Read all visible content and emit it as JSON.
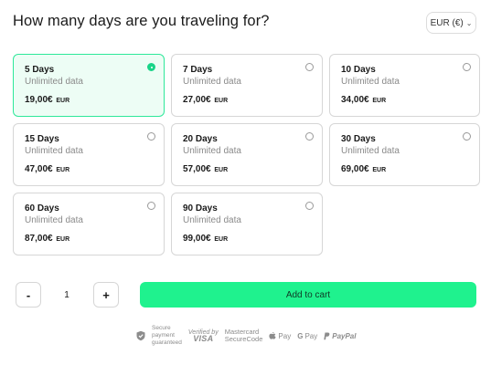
{
  "header": {
    "title": "How many days are you traveling for?",
    "currency_label": "EUR (€)",
    "currency_chevron_icon": "chevron-down-icon"
  },
  "plans": [
    {
      "days": "5 Days",
      "data": "Unlimited data",
      "price": "19,00€",
      "currency": "EUR",
      "selected": true
    },
    {
      "days": "7 Days",
      "data": "Unlimited data",
      "price": "27,00€",
      "currency": "EUR",
      "selected": false
    },
    {
      "days": "10 Days",
      "data": "Unlimited data",
      "price": "34,00€",
      "currency": "EUR",
      "selected": false
    },
    {
      "days": "15 Days",
      "data": "Unlimited data",
      "price": "47,00€",
      "currency": "EUR",
      "selected": false
    },
    {
      "days": "20 Days",
      "data": "Unlimited data",
      "price": "57,00€",
      "currency": "EUR",
      "selected": false
    },
    {
      "days": "30 Days",
      "data": "Unlimited data",
      "price": "69,00€",
      "currency": "EUR",
      "selected": false
    },
    {
      "days": "60 Days",
      "data": "Unlimited data",
      "price": "87,00€",
      "currency": "EUR",
      "selected": false
    },
    {
      "days": "90 Days",
      "data": "Unlimited data",
      "price": "99,00€",
      "currency": "EUR",
      "selected": false
    }
  ],
  "quantity": {
    "minus_label": "-",
    "value": "1",
    "plus_label": "+"
  },
  "cart": {
    "button_label": "Add to cart"
  },
  "payment": {
    "secure_line1": "Secure",
    "secure_line2": "payment",
    "secure_line3": "guaranteed",
    "visa_top": "Verified by",
    "visa_brand": "VISA",
    "mastercard_line1": "Mastercard",
    "mastercard_line2": "SecureCode",
    "applepay": "Pay",
    "googlepay": "Pay",
    "paypal": "PayPal"
  },
  "colors": {
    "accent": "#1ff28e",
    "selected_border": "#2ee89a",
    "selected_bg": "#edfdf5"
  }
}
